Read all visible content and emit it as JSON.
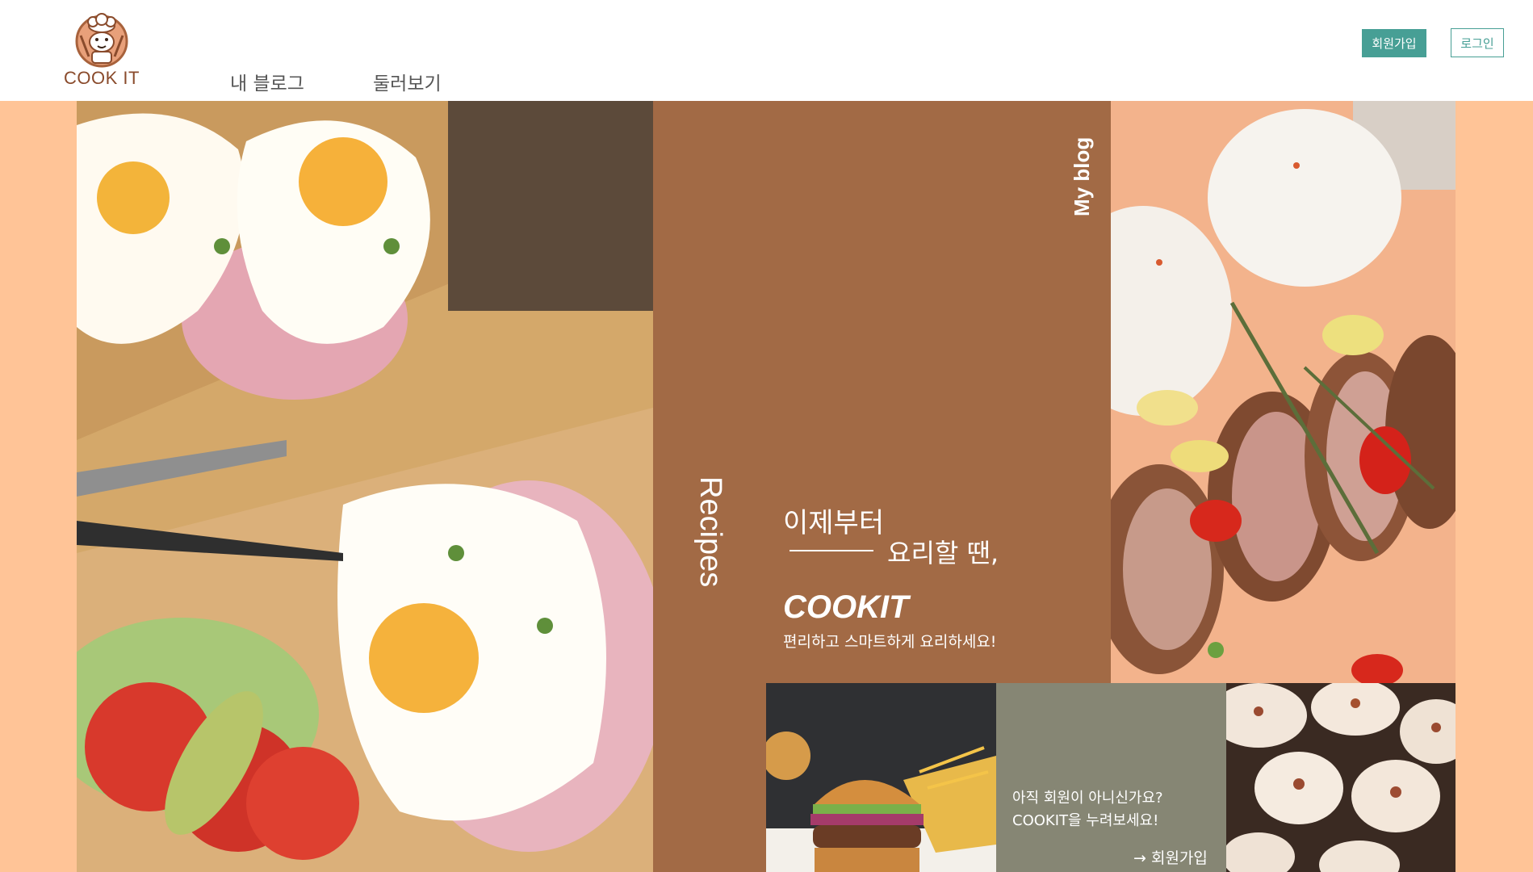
{
  "brand": {
    "logo_text": "COOK IT"
  },
  "nav": [
    {
      "label": "내 블로그"
    },
    {
      "label": "둘러보기"
    }
  ],
  "header_buttons": {
    "join": "회원가입",
    "login": "로그인"
  },
  "hero": {
    "side_label_left": "Recipes",
    "side_label_right": "My blog",
    "line1": "이제부터",
    "line2": "요리할 땐,",
    "brand": "COOKIT",
    "subtitle": "편리하고 스마트하게 요리하세요!"
  },
  "cta": {
    "line1": "아직 회원이 아니신가요?",
    "line2": "COOKIT을 누려보세요!",
    "link": "→ 회원가입"
  },
  "colors": {
    "background": "#ffc497",
    "brown_panel": "#a26a45",
    "gray_panel": "#868674",
    "accent": "#479f95"
  },
  "images": [
    {
      "name": "eggs-ham-toast-photo",
      "desc_icon": "food-photo"
    },
    {
      "name": "pork-rice-plate-photo",
      "desc_icon": "food-photo"
    },
    {
      "name": "burger-photo",
      "desc_icon": "food-photo"
    },
    {
      "name": "cupcakes-photo",
      "desc_icon": "food-photo"
    }
  ]
}
